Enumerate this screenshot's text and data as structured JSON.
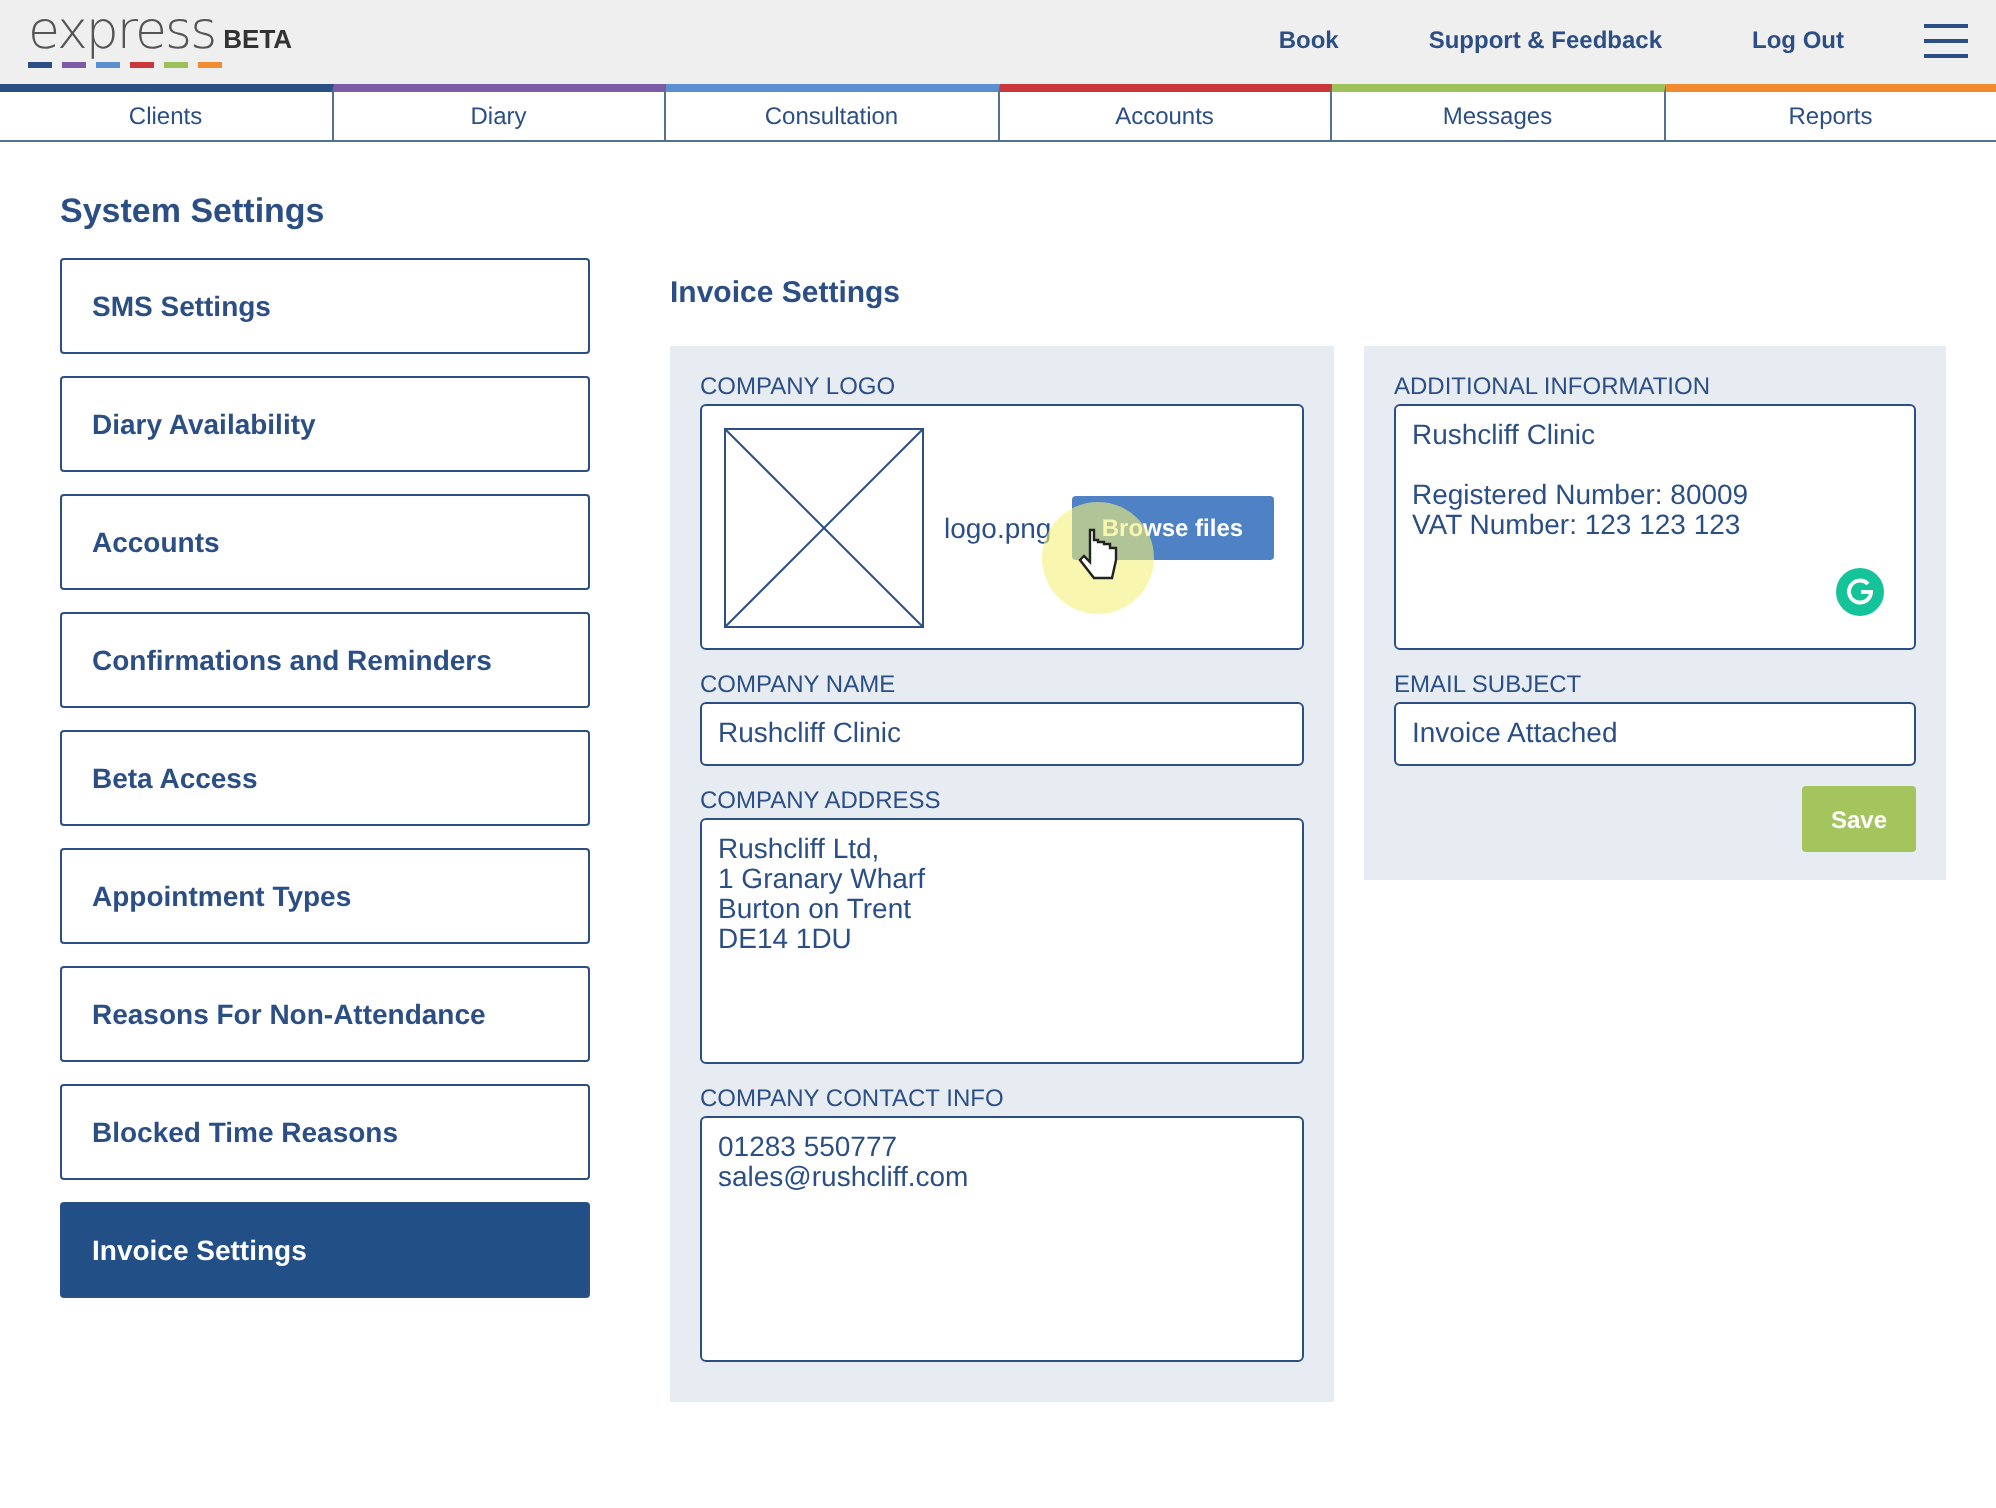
{
  "header": {
    "logo": "express",
    "badge": "BETA",
    "links": [
      "Book",
      "Support & Feedback",
      "Log Out"
    ]
  },
  "tabs": [
    {
      "label": "Clients",
      "color": "#2b4f85"
    },
    {
      "label": "Diary",
      "color": "#7d5aa6"
    },
    {
      "label": "Consultation",
      "color": "#5b8fd0"
    },
    {
      "label": "Accounts",
      "color": "#c9373a"
    },
    {
      "label": "Messages",
      "color": "#9dc25a"
    },
    {
      "label": "Reports",
      "color": "#f28a30"
    }
  ],
  "sidebar": {
    "title": "System Settings",
    "items": [
      {
        "label": "SMS Settings",
        "selected": false
      },
      {
        "label": "Diary Availability",
        "selected": false
      },
      {
        "label": "Accounts",
        "selected": false
      },
      {
        "label": "Confirmations and Reminders",
        "selected": false
      },
      {
        "label": "Beta Access",
        "selected": false
      },
      {
        "label": "Appointment Types",
        "selected": false
      },
      {
        "label": "Reasons For Non-Attendance",
        "selected": false
      },
      {
        "label": "Blocked Time Reasons",
        "selected": false
      },
      {
        "label": "Invoice Settings",
        "selected": true
      }
    ]
  },
  "main": {
    "title": "Invoice Settings",
    "logo_field": {
      "label": "COMPANY LOGO",
      "filename": "logo.png",
      "button": "Browse files"
    },
    "left_fields": [
      {
        "label": "COMPANY NAME",
        "value": "Rushcliff Clinic",
        "kind": "input"
      },
      {
        "label": "COMPANY ADDRESS",
        "value": "Rushcliff Ltd,\n1 Granary Wharf\nBurton on Trent\nDE14 1DU",
        "kind": "textarea"
      },
      {
        "label": "COMPANY CONTACT INFO",
        "value": "01283 550777\nsales@rushcliff.com",
        "kind": "textarea"
      }
    ],
    "right_fields": [
      {
        "label": "ADDITIONAL INFORMATION",
        "value": "Rushcliff Clinic\n\nRegistered Number: 80009\nVAT Number: 123 123 123",
        "kind": "textarea"
      },
      {
        "label": "EMAIL SUBJECT",
        "value": "Invoice Attached",
        "kind": "input"
      }
    ],
    "save": "Save"
  }
}
